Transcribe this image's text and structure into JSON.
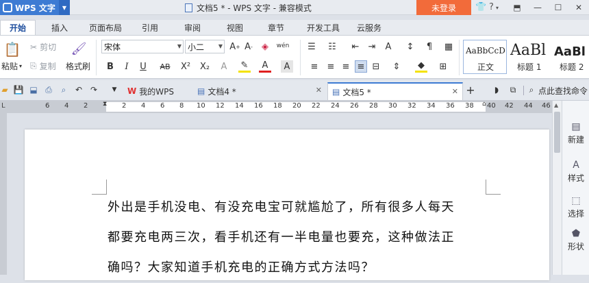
{
  "app": {
    "name": "WPS 文字",
    "title": "文档5 * - WPS 文字 - 兼容模式",
    "login": "未登录"
  },
  "title_icons": [
    "shirt-icon",
    "help-icon"
  ],
  "ribbon_tabs": [
    "开始",
    "插入",
    "页面布局",
    "引用",
    "审阅",
    "视图",
    "章节",
    "开发工具",
    "云服务"
  ],
  "clipboard": {
    "paste": "粘贴",
    "cut": "剪切",
    "copy": "复制",
    "format_painter": "格式刷"
  },
  "font": {
    "family": "宋体",
    "size": "小二"
  },
  "styles": [
    {
      "sample": "AaBbCcD",
      "name": "正文"
    },
    {
      "sample": "AaBl",
      "name": "标题 1"
    },
    {
      "sample": "AaBl",
      "name": "标题 2"
    }
  ],
  "doc_tabs": [
    {
      "label": "我的WPS"
    },
    {
      "label": "文档4 *"
    },
    {
      "label": "文档5 *"
    }
  ],
  "find_label": "点此查找命令",
  "ruler_ticks": [
    "6",
    "4",
    "2",
    "2",
    "4",
    "6",
    "8",
    "10",
    "12",
    "14",
    "16",
    "18",
    "20",
    "22",
    "24",
    "26",
    "28",
    "30",
    "32",
    "34",
    "36",
    "38",
    "40",
    "42",
    "44",
    "46"
  ],
  "document": {
    "lines": [
      "外出是手机没电、有没充电宝可就尴尬了，所有很多人每天",
      "都要充电两三次，看手机还有一半电量也要充，这种做法正",
      "确吗？大家知道手机充电的正确方式方法吗？"
    ]
  },
  "side_panel": [
    "新建",
    "样式",
    "选择",
    "形状"
  ]
}
